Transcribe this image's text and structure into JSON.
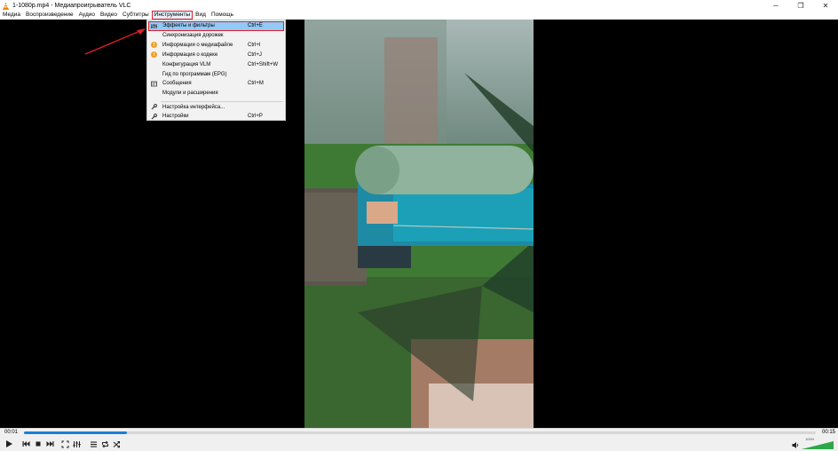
{
  "window": {
    "title": "1-1080p.mp4 - Медиапроигрыватель VLC",
    "minimize_glyph": "─",
    "maximize_glyph": "❐",
    "close_glyph": "✕"
  },
  "menubar": {
    "items": [
      "Медиа",
      "Воспроизведение",
      "Аудио",
      "Видео",
      "Субтитры",
      "Инструменты",
      "Вид",
      "Помощь"
    ],
    "active_index": 5
  },
  "tools_menu": {
    "items": [
      {
        "label": "Эффекты и фильтры",
        "shortcut": "Ctrl+E",
        "icon": "equalizer-icon",
        "highlighted": true
      },
      {
        "label": "Синхронизация дорожек",
        "shortcut": "",
        "icon": ""
      },
      {
        "label": "Информация о медиафайле",
        "shortcut": "Ctrl+I",
        "icon": "info-icon"
      },
      {
        "label": "Информация о кодеке",
        "shortcut": "Ctrl+J",
        "icon": "info-icon"
      },
      {
        "label": "Конфигурация VLM",
        "shortcut": "Ctrl+Shift+W",
        "icon": ""
      },
      {
        "label": "Гид по программам (EPG)",
        "shortcut": "",
        "icon": ""
      },
      {
        "label": "Сообщения",
        "shortcut": "Ctrl+M",
        "icon": "messages-icon"
      },
      {
        "label": "Модули и расширения",
        "shortcut": "",
        "icon": ""
      },
      {
        "label": "Настройка интерфейса...",
        "shortcut": "",
        "icon": "wrench-icon"
      },
      {
        "label": "Настройки",
        "shortcut": "Ctrl+P",
        "icon": "wrench-icon"
      }
    ]
  },
  "controls": {
    "elapsed": "00:01",
    "total": "00:15",
    "progress": 0.13,
    "volume_label": "100%",
    "volume": 1.0
  },
  "colors": {
    "accent": "#1a7fd4",
    "highlight": "#91c9f7",
    "annotation_red": "#e0202a"
  }
}
